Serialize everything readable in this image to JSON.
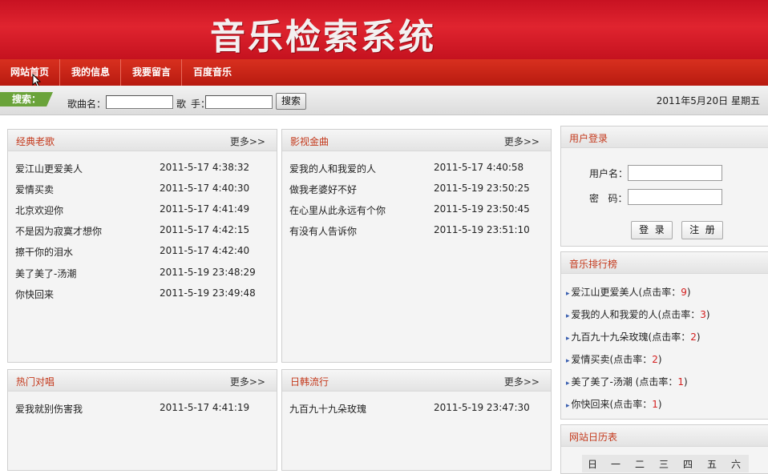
{
  "banner": {
    "title": "音乐检索系统"
  },
  "nav": {
    "items": [
      "网站首页",
      "我的信息",
      "我要留言",
      "百度音乐"
    ]
  },
  "search": {
    "tag": "搜索：",
    "song_label": "歌曲名：",
    "singer_label_a": "歌",
    "singer_label_b": "手：",
    "song_value": "",
    "singer_value": "",
    "button": "搜索"
  },
  "date_text": "2011年5月20日  星期五",
  "panels": {
    "classic": {
      "title": "经典老歌",
      "more": "更多>>",
      "rows": [
        {
          "title": "爱江山更爱美人",
          "date": "2011-5-17 4:38:32"
        },
        {
          "title": "爱情买卖",
          "date": "2011-5-17 4:40:30"
        },
        {
          "title": "北京欢迎你",
          "date": "2011-5-17 4:41:49"
        },
        {
          "title": "不是因为寂寞才想你",
          "date": "2011-5-17 4:42:15"
        },
        {
          "title": "擦干你的泪水",
          "date": "2011-5-17 4:42:40"
        },
        {
          "title": "美了美了-汤潮",
          "date": "2011-5-19 23:48:29"
        },
        {
          "title": "你快回来",
          "date": "2011-5-19 23:49:48"
        }
      ]
    },
    "film": {
      "title": "影视金曲",
      "more": "更多>>",
      "rows": [
        {
          "title": "爱我的人和我爱的人",
          "date": "2011-5-17 4:40:58"
        },
        {
          "title": "做我老婆好不好",
          "date": "2011-5-19 23:50:25"
        },
        {
          "title": "在心里从此永远有个你",
          "date": "2011-5-19 23:50:45"
        },
        {
          "title": "有没有人告诉你",
          "date": "2011-5-19 23:51:10"
        }
      ]
    },
    "duet": {
      "title": "热门对唱",
      "more": "更多>>",
      "rows": [
        {
          "title": "爱我就别伤害我",
          "date": "2011-5-17 4:41:19"
        }
      ]
    },
    "jk": {
      "title": "日韩流行",
      "more": "更多>>",
      "rows": [
        {
          "title": "九百九十九朵玫瑰",
          "date": "2011-5-19 23:47:30"
        }
      ]
    }
  },
  "login": {
    "title": "用户登录",
    "user_label": "用户名：",
    "pwd_label": "密   码：",
    "user_value": "",
    "pwd_value": "",
    "login_btn": "登  录",
    "register_btn": "注  册"
  },
  "rank": {
    "title": "音乐排行榜",
    "items": [
      {
        "name": "爱江山更爱美人(点击率：",
        "count": "9",
        "close": ")"
      },
      {
        "name": "爱我的人和我爱的人(点击率：",
        "count": "3",
        "close": ")"
      },
      {
        "name": "九百九十九朵玫瑰(点击率：",
        "count": "2",
        "close": ")"
      },
      {
        "name": "爱情买卖(点击率：",
        "count": "2",
        "close": ")"
      },
      {
        "name": "美了美了-汤潮 (点击率：",
        "count": "1",
        "close": ")"
      },
      {
        "name": "你快回来(点击率：",
        "count": "1",
        "close": ")"
      }
    ]
  },
  "calendar": {
    "title": "网站日历表",
    "days": [
      "日",
      "一",
      "二",
      "三",
      "四",
      "五",
      "六"
    ]
  }
}
